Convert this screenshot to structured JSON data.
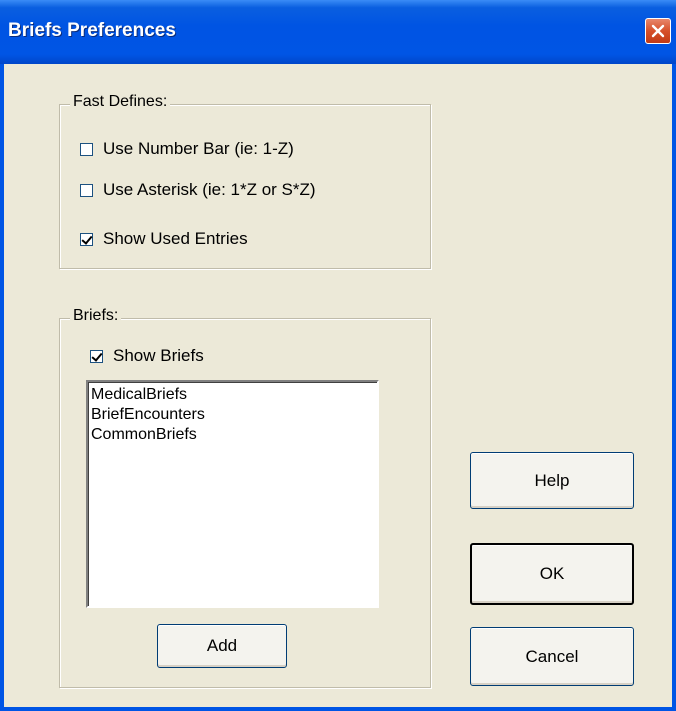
{
  "window": {
    "title": "Briefs Preferences"
  },
  "fast_defines": {
    "label": "Fast Defines:",
    "options": [
      {
        "label": "Use Number Bar (ie:  1-Z)",
        "checked": false
      },
      {
        "label": "Use Asterisk (ie: 1*Z or S*Z)",
        "checked": false
      },
      {
        "label": "Show Used Entries",
        "checked": true
      }
    ]
  },
  "briefs": {
    "label": "Briefs:",
    "show_briefs": {
      "label": "Show Briefs",
      "checked": true
    },
    "items": [
      "MedicalBriefs",
      "BriefEncounters",
      "CommonBriefs"
    ],
    "add_label": "Add"
  },
  "buttons": {
    "help": "Help",
    "ok": "OK",
    "cancel": "Cancel"
  }
}
